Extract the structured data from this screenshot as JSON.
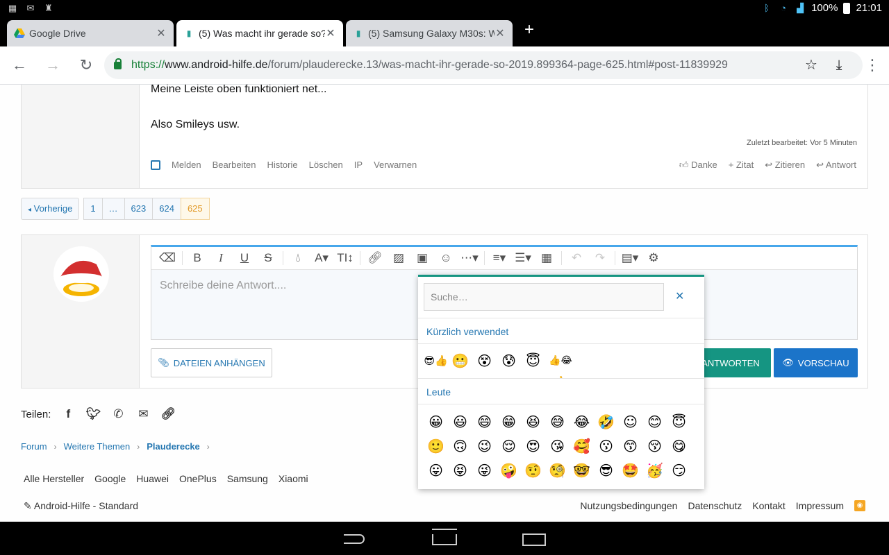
{
  "status": {
    "battery": "100%",
    "time": "21:01"
  },
  "tabs": [
    {
      "title": "Google Drive",
      "active": false
    },
    {
      "title": "(5) Was macht ihr gerade so?",
      "active": true
    },
    {
      "title": "(5) Samsung Galaxy M30s: Wo",
      "active": false
    }
  ],
  "address": {
    "scheme": "https://",
    "host": "www.android-hilfe.de",
    "path": "/forum/plauderecke.13/was-macht-ihr-gerade-so-2019.899364-page-625.html#post-11839929"
  },
  "post": {
    "line1": "Meine Leiste oben funktioniert net...",
    "line2": "Also Smileys usw.",
    "edited": "Zuletzt bearbeitet: Vor 5 Minuten",
    "actions": [
      "Melden",
      "Bearbeiten",
      "Historie",
      "Löschen",
      "IP",
      "Verwarnen"
    ],
    "actions_right": [
      "Danke",
      "Zitat",
      "Zitieren",
      "Antwort"
    ]
  },
  "pager": {
    "prev": "Vorherige",
    "pages": [
      "1",
      "…",
      "623",
      "624",
      "625"
    ],
    "current": "625"
  },
  "editor": {
    "placeholder": "Schreibe deine Antwort...."
  },
  "buttons": {
    "attach": "DATEIEN ANHÄNGEN",
    "answer": "ANTWORTEN",
    "preview": "VORSCHAU"
  },
  "emoji_popup": {
    "search_placeholder": "Suche…",
    "section_recent": "Kürzlich verwendet",
    "section_people": "Leute",
    "recent": [
      "😎👍",
      "😬",
      "😵",
      "😰",
      "😇",
      "👍😂👍"
    ],
    "people_rows": [
      [
        "😀",
        "😃",
        "😄",
        "😁",
        "😆",
        "😅",
        "😂",
        "🤣",
        "☺",
        "😊",
        "😇"
      ],
      [
        "🙂",
        "🙃",
        "😉",
        "😌",
        "😍",
        "😘",
        "🥰",
        "😗",
        "😙",
        "😚",
        "😋"
      ],
      [
        "😛",
        "😝",
        "😜",
        "🤪",
        "🤨",
        "🧐",
        "🤓",
        "😎",
        "🤩",
        "🥳",
        "😏"
      ]
    ]
  },
  "share": {
    "label": "Teilen:"
  },
  "breadcrumbs": [
    "Forum",
    "Weitere Themen",
    "Plauderecke"
  ],
  "brands": [
    "Alle Hersteller",
    "Google",
    "Huawei",
    "OnePlus",
    "Samsung",
    "Xiaomi"
  ],
  "footer": {
    "style": "Android-Hilfe - Standard",
    "links": [
      "Nutzungsbedingungen",
      "Datenschutz",
      "Kontakt",
      "Impressum"
    ]
  }
}
